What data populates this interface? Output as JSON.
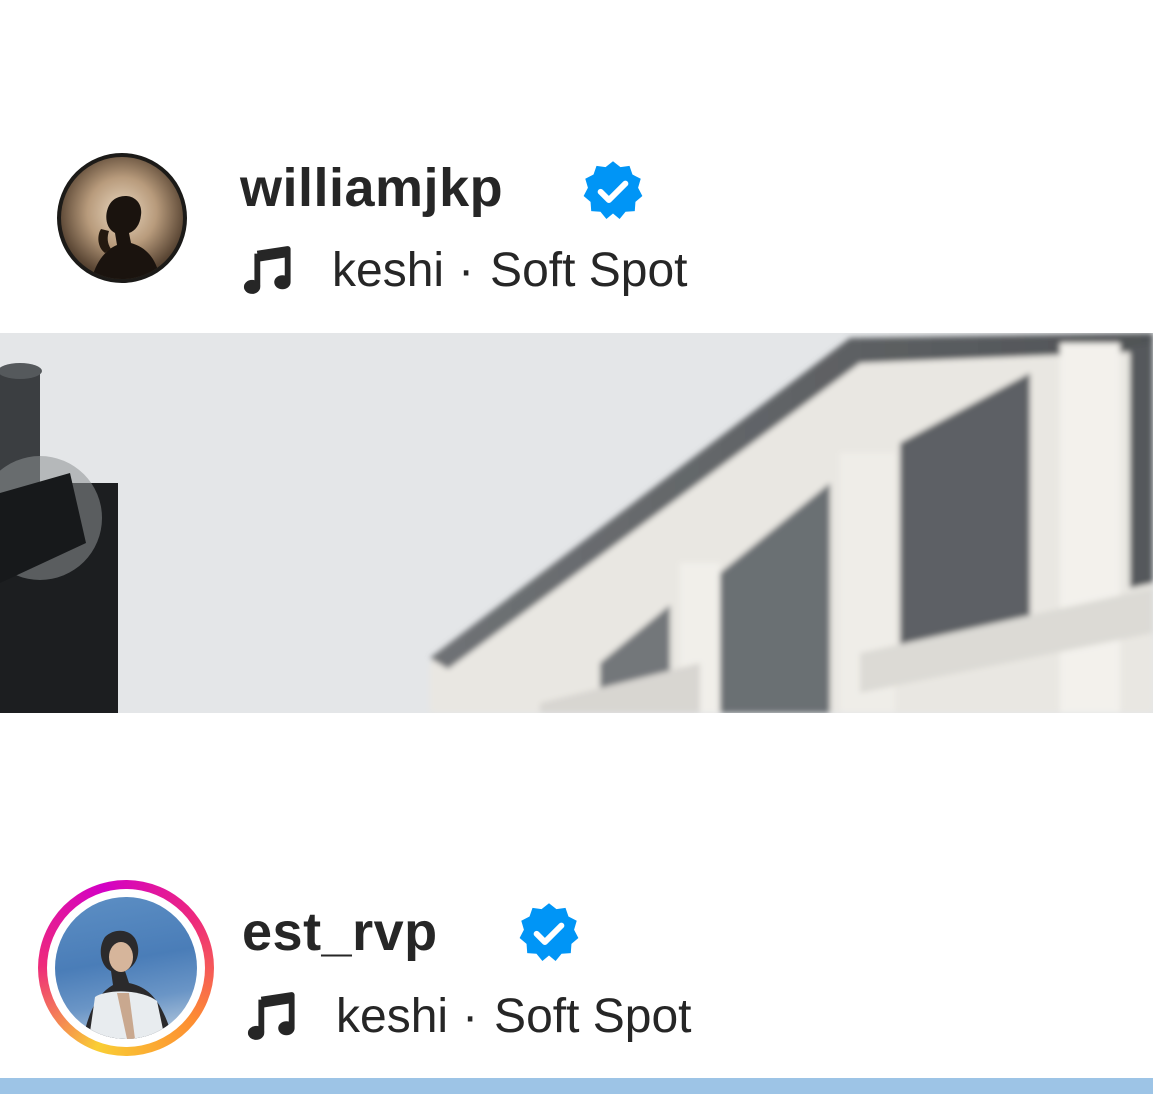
{
  "posts": [
    {
      "username": "williamjkp",
      "verified": true,
      "verified_icon": "verified-badge-icon",
      "music_icon": "music-note-icon",
      "artist": "keshi",
      "separator": "·",
      "song": "Soft Spot",
      "has_story_ring": false
    },
    {
      "username": "est_rvp",
      "verified": true,
      "verified_icon": "verified-badge-icon",
      "music_icon": "music-note-icon",
      "artist": "keshi",
      "separator": "·",
      "song": "Soft Spot",
      "has_story_ring": true
    }
  ],
  "colors": {
    "verified_blue": "#0095f6",
    "text": "#262626",
    "story_ring": [
      "#f9ce34",
      "#ee2a7b",
      "#d300c5",
      "#fd8d32"
    ]
  }
}
